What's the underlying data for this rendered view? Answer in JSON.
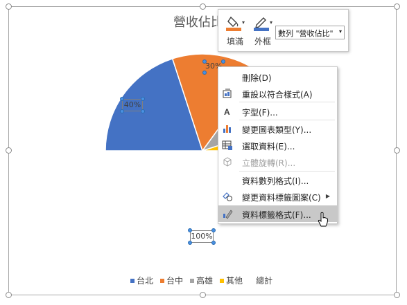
{
  "chart": {
    "title": "營收佔比",
    "data_labels": {
      "taipei": "40%",
      "taichung": "30%",
      "total": "100%"
    },
    "legend": [
      {
        "label": "台北",
        "color": "#4472c4"
      },
      {
        "label": "台中",
        "color": "#ed7d31"
      },
      {
        "label": "高雄",
        "color": "#a5a5a5"
      },
      {
        "label": "其他",
        "color": "#ffc000"
      },
      {
        "label": "總計",
        "color": ""
      }
    ]
  },
  "chart_data": {
    "type": "pie",
    "title": "營收佔比",
    "categories": [
      "台北",
      "台中",
      "高雄",
      "其他",
      "總計"
    ],
    "values": [
      40,
      30,
      20,
      10,
      100
    ],
    "data_labels": [
      "40%",
      "30%",
      "",
      "",
      "100%"
    ],
    "colors": [
      "#4472c4",
      "#ed7d31",
      "#a5a5a5",
      "#ffc000",
      ""
    ],
    "legend_position": "bottom"
  },
  "mini_toolbar": {
    "fill_label": "填滿",
    "outline_label": "外框",
    "series_select": "數列 \"營收佔比\"",
    "fill_icon": "paint-bucket-icon",
    "outline_icon": "pen-outline-icon"
  },
  "context_menu": {
    "items": [
      {
        "label": "刪除(D)",
        "icon": "",
        "disabled": false
      },
      {
        "label": "重設以符合樣式(A)",
        "icon": "reset-style-icon",
        "disabled": false
      },
      {
        "label": "字型(F)...",
        "icon": "font-icon",
        "disabled": false
      },
      {
        "label": "變更圖表類型(Y)...",
        "icon": "chart-type-icon",
        "disabled": false
      },
      {
        "label": "選取資料(E)...",
        "icon": "select-data-icon",
        "disabled": false
      },
      {
        "label": "立體旋轉(R)...",
        "icon": "3d-rotation-icon",
        "disabled": true
      },
      {
        "label": "資料數列格式(I)...",
        "icon": "",
        "disabled": false
      },
      {
        "label": "變更資料標籤圖案(C)",
        "icon": "change-shape-icon",
        "disabled": false
      },
      {
        "label": "資料標籤格式(F)...",
        "icon": "format-label-icon",
        "disabled": false
      }
    ]
  }
}
